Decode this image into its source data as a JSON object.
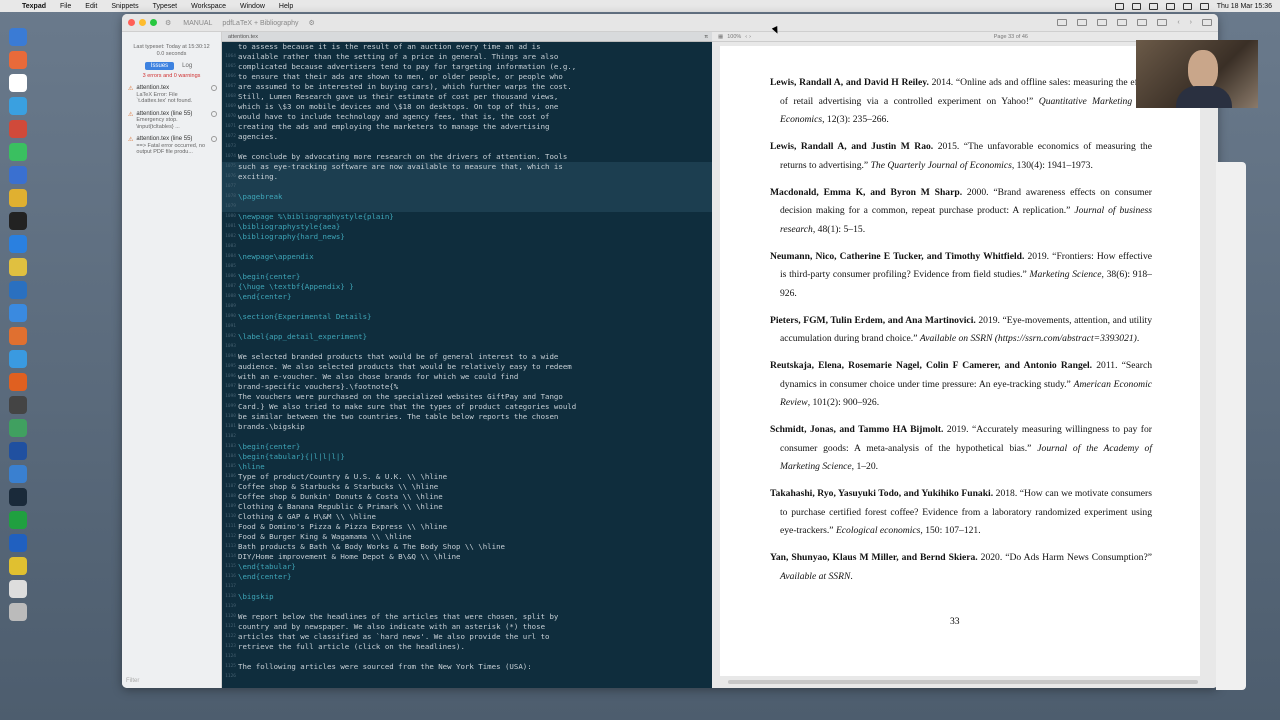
{
  "menubar": {
    "app": "Texpad",
    "items": [
      "File",
      "Edit",
      "Snippets",
      "Typeset",
      "Workspace",
      "Window",
      "Help"
    ],
    "clock": "Thu 18 Mar 15:36"
  },
  "titlebar": {
    "crumbs": [
      "MANUAL",
      "pdfLaTeX + Bibliography"
    ]
  },
  "sidebar": {
    "last_typeset": "Last typeset: Today at 15:30:12",
    "duration": "0.0 seconds",
    "tab_issues": "Issues",
    "tab_log": "Log",
    "summary": "3 errors and 0 warnings",
    "issues": [
      {
        "title": "attention.tex",
        "detail": "LaTeX Error: File `t.dattex.tex' not found."
      },
      {
        "title": "attention.tex (line 55)",
        "detail": "Emergency stop. \\input{tcltables} ..."
      },
      {
        "title": "attention.tex (line 55)",
        "detail": "==> Fatal error occurred, no output PDF file produ..."
      }
    ],
    "filter": "Filter"
  },
  "editor": {
    "filename": "attention.tex",
    "lines": [
      {
        "n": "",
        "t": "to assess because it is the result of an auction every time an ad is",
        "c": ""
      },
      {
        "n": "1064",
        "t": "available rather than the setting of a price in general. Things are also",
        "c": ""
      },
      {
        "n": "1065",
        "t": "complicated because advertisers tend to pay for targeting information (e.g.,",
        "c": ""
      },
      {
        "n": "1066",
        "t": "to ensure that their ads are shown to men, or older people, or people who",
        "c": ""
      },
      {
        "n": "1067",
        "t": "are assumed to be interested in buying cars), which further warps the cost.",
        "c": ""
      },
      {
        "n": "1068",
        "t": "Still, Lumen Research gave us their estimate of cost per thousand views,",
        "c": ""
      },
      {
        "n": "1069",
        "t": "which is \\$3 on mobile devices and \\$18 on desktops. On top of this, one",
        "c": ""
      },
      {
        "n": "1070",
        "t": "would have to include technology and agency fees, that is, the cost of",
        "c": ""
      },
      {
        "n": "1071",
        "t": "creating the ads and employing the marketers to manage the advertising",
        "c": ""
      },
      {
        "n": "1072",
        "t": "agencies.",
        "c": ""
      },
      {
        "n": "1073",
        "t": "",
        "c": ""
      },
      {
        "n": "1074",
        "t": "We conclude by advocating more research on the drivers of attention. Tools",
        "c": ""
      },
      {
        "n": "1075",
        "t": "such as eye-tracking software are now available to measure that, which is",
        "c": "hl"
      },
      {
        "n": "1076",
        "t": "exciting.",
        "c": "hl"
      },
      {
        "n": "1077",
        "t": "",
        "c": "hl"
      },
      {
        "n": "1078",
        "t": "\\pagebreak",
        "c": "hl cmd"
      },
      {
        "n": "1079",
        "t": "",
        "c": "hl"
      },
      {
        "n": "1080",
        "t": "\\newpage %\\bibliographystyle{plain}",
        "c": "cmd"
      },
      {
        "n": "1081",
        "t": "\\bibliographystyle{aea}",
        "c": "cmd"
      },
      {
        "n": "1082",
        "t": "\\bibliography{hard_news}",
        "c": "cmd"
      },
      {
        "n": "1083",
        "t": "",
        "c": ""
      },
      {
        "n": "1084",
        "t": "\\newpage\\appendix",
        "c": "cmd"
      },
      {
        "n": "1085",
        "t": "",
        "c": ""
      },
      {
        "n": "1086",
        "t": "\\begin{center}",
        "c": "cmd"
      },
      {
        "n": "1087",
        "t": "{\\huge \\textbf{Appendix} }",
        "c": "cmd"
      },
      {
        "n": "1088",
        "t": "\\end{center}",
        "c": "cmd"
      },
      {
        "n": "1089",
        "t": "",
        "c": ""
      },
      {
        "n": "1090",
        "t": "\\section{Experimental Details}",
        "c": "cmd"
      },
      {
        "n": "1091",
        "t": "",
        "c": ""
      },
      {
        "n": "1092",
        "t": "\\label{app_detail_experiment}",
        "c": "cmd"
      },
      {
        "n": "1093",
        "t": "",
        "c": ""
      },
      {
        "n": "1094",
        "t": "We selected branded products that would be of general interest to a wide",
        "c": ""
      },
      {
        "n": "1095",
        "t": "audience. We also selected products that would be relatively easy to redeem",
        "c": ""
      },
      {
        "n": "1096",
        "t": "with an e-voucher. We also chose brands for which we could find",
        "c": ""
      },
      {
        "n": "1097",
        "t": "brand-specific vouchers}.\\footnote{%",
        "c": ""
      },
      {
        "n": "1098",
        "t": "The vouchers were purchased on the specialized websites GiftPay and Tango",
        "c": ""
      },
      {
        "n": "1099",
        "t": "Card.} We also tried to make sure that the types of product categories would",
        "c": ""
      },
      {
        "n": "1100",
        "t": "be similar between the two countries. The table below reports the chosen",
        "c": ""
      },
      {
        "n": "1101",
        "t": "brands.\\bigskip",
        "c": ""
      },
      {
        "n": "1102",
        "t": "",
        "c": ""
      },
      {
        "n": "1103",
        "t": "\\begin{center}",
        "c": "cmd"
      },
      {
        "n": "1104",
        "t": "\\begin{tabular}{|l|l|l|}",
        "c": "cmd"
      },
      {
        "n": "1105",
        "t": "\\hline",
        "c": "cmd"
      },
      {
        "n": "1106",
        "t": "Type of product/Country & U.S. & U.K. \\\\ \\hline",
        "c": ""
      },
      {
        "n": "1107",
        "t": "Coffee shop & Starbucks & Starbucks \\\\ \\hline",
        "c": ""
      },
      {
        "n": "1108",
        "t": "Coffee shop & Dunkin' Donuts & Costa \\\\ \\hline",
        "c": ""
      },
      {
        "n": "1109",
        "t": "Clothing & Banana Republic & Primark \\\\ \\hline",
        "c": ""
      },
      {
        "n": "1110",
        "t": "Clothing & GAP & H\\&M \\\\ \\hline",
        "c": ""
      },
      {
        "n": "1111",
        "t": "Food & Domino's Pizza & Pizza Express \\\\ \\hline",
        "c": ""
      },
      {
        "n": "1112",
        "t": "Food & Burger King & Wagamama \\\\ \\hline",
        "c": ""
      },
      {
        "n": "1113",
        "t": "Bath products & Bath \\& Body Works & The Body Shop \\\\ \\hline",
        "c": ""
      },
      {
        "n": "1114",
        "t": "DIY/Home improvement & Home Depot & B\\&Q \\\\ \\hline",
        "c": ""
      },
      {
        "n": "1115",
        "t": "\\end{tabular}",
        "c": "cmd"
      },
      {
        "n": "1116",
        "t": "\\end{center}",
        "c": "cmd"
      },
      {
        "n": "1117",
        "t": "",
        "c": ""
      },
      {
        "n": "1118",
        "t": "\\bigskip",
        "c": "cmd"
      },
      {
        "n": "1119",
        "t": "",
        "c": ""
      },
      {
        "n": "1120",
        "t": "We report below the headlines of the articles that were chosen, split by",
        "c": ""
      },
      {
        "n": "1121",
        "t": "country and by newspaper. We also indicate with an asterisk (*) those",
        "c": ""
      },
      {
        "n": "1122",
        "t": "articles that we classified as `hard news'. We also provide the url to",
        "c": ""
      },
      {
        "n": "1123",
        "t": "retrieve the full article (click on the headlines).",
        "c": ""
      },
      {
        "n": "1124",
        "t": "",
        "c": ""
      },
      {
        "n": "1125",
        "t": "The following articles were sourced from the New York Times (USA):",
        "c": ""
      },
      {
        "n": "1126",
        "t": "",
        "c": ""
      }
    ]
  },
  "pdf": {
    "zoom": "100%",
    "page_indicator": "Page 33 of 46",
    "page_number": "33",
    "entries": [
      {
        "authors": "Lewis, Randall A, and David H Reiley.",
        "rest": " 2014. “Online ads and offline sales: measuring the effect of retail advertising via a controlled experiment on Yahoo!” ",
        "journal": "Quantitative Marketing and Economics",
        "tail": ", 12(3): 235–266."
      },
      {
        "authors": "Lewis, Randall A, and Justin M Rao.",
        "rest": " 2015. “The unfavorable economics of measuring the returns to advertising.” ",
        "journal": "The Quarterly Journal of Economics",
        "tail": ", 130(4): 1941–1973."
      },
      {
        "authors": "Macdonald, Emma K, and Byron M Sharp.",
        "rest": " 2000. “Brand awareness effects on consumer decision making for a common, repeat purchase product: A replication.” ",
        "journal": "Journal of business research",
        "tail": ", 48(1): 5–15."
      },
      {
        "authors": "Neumann, Nico, Catherine E Tucker, and Timothy Whitfield.",
        "rest": " 2019. “Frontiers: How effective is third-party consumer profiling? Evidence from field studies.” ",
        "journal": "Marketing Science",
        "tail": ", 38(6): 918–926."
      },
      {
        "authors": "Pieters, FGM, Tulin Erdem, and Ana Martinovici.",
        "rest": " 2019. “Eye-movements, attention, and utility accumulation during brand choice.” ",
        "journal": "Available on SSRN (https://ssrn.com/abstract=3393021)",
        "tail": "."
      },
      {
        "authors": "Reutskaja, Elena, Rosemarie Nagel, Colin F Camerer, and Antonio Rangel.",
        "rest": " 2011. “Search dynamics in consumer choice under time pressure: An eye-tracking study.” ",
        "journal": "American Economic Review",
        "tail": ", 101(2): 900–926."
      },
      {
        "authors": "Schmidt, Jonas, and Tammo HA Bijmolt.",
        "rest": " 2019. “Accurately measuring willingness to pay for consumer goods: A meta-analysis of the hypothetical bias.” ",
        "journal": "Journal of the Academy of Marketing Science",
        "tail": ", 1–20."
      },
      {
        "authors": "Takahashi, Ryo, Yasuyuki Todo, and Yukihiko Funaki.",
        "rest": " 2018. “How can we motivate consumers to purchase certified forest coffee? Evidence from a laboratory randomized experiment using eye-trackers.” ",
        "journal": "Ecological economics",
        "tail": ", 150: 107–121."
      },
      {
        "authors": "Yan, Shunyao, Klaus M Miller, and Bernd Skiera.",
        "rest": " 2020. “Do Ads Harm News Consumption?” ",
        "journal": "Available at SSRN",
        "tail": "."
      }
    ]
  },
  "colors": {
    "editor_bg": "#0f2d3d",
    "accent": "#3d82e0",
    "error": "#d03030"
  }
}
